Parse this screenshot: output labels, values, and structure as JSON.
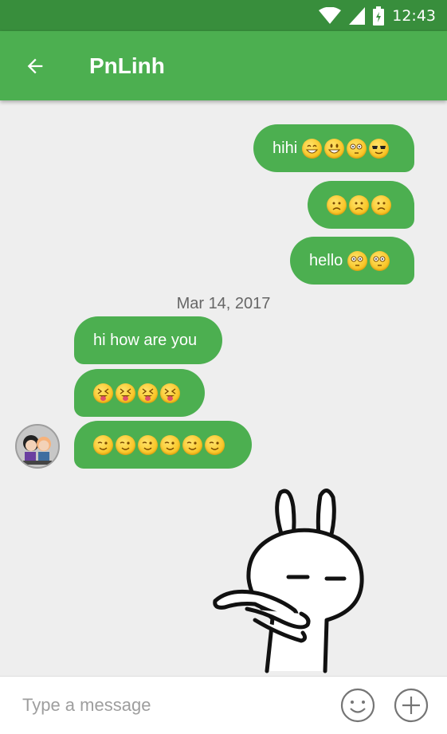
{
  "status_bar": {
    "time": "12:43",
    "icons": [
      "wifi-icon",
      "signal-icon",
      "battery-icon"
    ]
  },
  "app_bar": {
    "title": "PnLinh",
    "back_icon": "arrow-back-icon",
    "color": "#4caf50"
  },
  "messages": [
    {
      "direction": "outgoing",
      "text": "hihi",
      "emojis": [
        "grin",
        "smiley",
        "thinking",
        "sunglasses"
      ]
    },
    {
      "direction": "outgoing",
      "text": "",
      "emojis": [
        "frown",
        "frown",
        "frown"
      ]
    },
    {
      "direction": "outgoing",
      "text": "hello",
      "emojis": [
        "thinking",
        "thinking"
      ]
    },
    {
      "direction": "incoming",
      "text": "hi how are you",
      "emojis": []
    },
    {
      "direction": "incoming",
      "text": "",
      "emojis": [
        "squint-tongue",
        "squint-tongue",
        "squint-tongue",
        "squint-tongue"
      ]
    },
    {
      "direction": "incoming",
      "text": "",
      "emojis": [
        "wink",
        "wink",
        "wink",
        "wink",
        "wink",
        "wink"
      ]
    },
    {
      "direction": "incoming",
      "type": "sticker",
      "sticker": "rabbit-sticker"
    }
  ],
  "date_separator": "Mar 14, 2017",
  "contact": {
    "avatar": "contact-avatar"
  },
  "composer": {
    "placeholder": "Type a message",
    "emoji_icon": "smiley-icon",
    "add_icon": "add-circle-icon"
  },
  "colors": {
    "bubble": "#4caf50",
    "status_bar": "#388e3c",
    "background": "#eeeeee"
  }
}
